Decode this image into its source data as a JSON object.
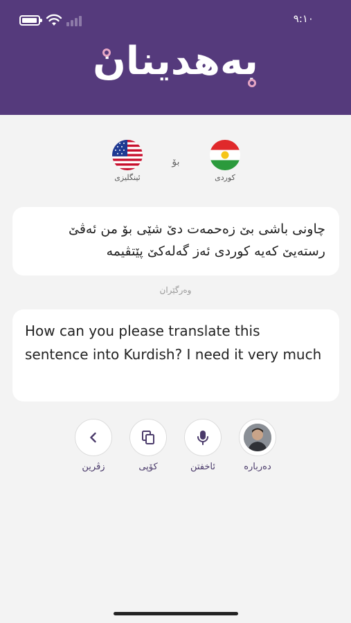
{
  "status_bar": {
    "time": "٩:١٠"
  },
  "header": {
    "logo_text": "بەهدینان"
  },
  "languages": {
    "target_label": "ئینگلیزی",
    "connector": "بۆ",
    "source_label": "کوردی"
  },
  "source_card": {
    "text_line1": "چاونی باشی بێ زەحمەت دێ شێی بۆ من ئەڤێ",
    "text_line2": "رستەیێ کەیە کوردی ئەز گەلەکێ پێتڤیمە"
  },
  "translated_label": "وەرگێران",
  "target_card": {
    "text": "How can you please translate this sentence into Kurdish? I need it very much"
  },
  "actions": {
    "back_label": "زڤرین",
    "copy_label": "کۆپی",
    "speak_label": "ئاخفتن",
    "about_label": "دەرباره"
  },
  "colors": {
    "header": "#553a7c",
    "accent_dot": "#e6a6c4"
  }
}
